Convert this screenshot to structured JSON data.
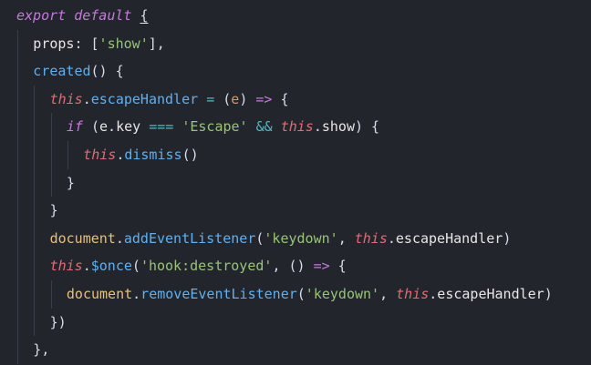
{
  "editor": {
    "background": "#22262c",
    "lines": [
      {
        "indent": 0,
        "tokens": [
          {
            "t": "export",
            "c": "kw"
          },
          {
            "t": " ",
            "c": "plain"
          },
          {
            "t": "default",
            "c": "kw"
          },
          {
            "t": " ",
            "c": "plain"
          },
          {
            "t": "{",
            "c": "punc cursor-underline"
          }
        ]
      },
      {
        "indent": 1,
        "tokens": [
          {
            "t": "props",
            "c": "prop"
          },
          {
            "t": ": [",
            "c": "punc"
          },
          {
            "t": "'show'",
            "c": "str"
          },
          {
            "t": "],",
            "c": "punc"
          }
        ]
      },
      {
        "indent": 1,
        "tokens": [
          {
            "t": "created",
            "c": "fn"
          },
          {
            "t": "() {",
            "c": "punc"
          }
        ]
      },
      {
        "indent": 2,
        "tokens": [
          {
            "t": "this",
            "c": "this"
          },
          {
            "t": ".",
            "c": "punc"
          },
          {
            "t": "escapeHandler",
            "c": "fn"
          },
          {
            "t": " ",
            "c": "plain"
          },
          {
            "t": "=",
            "c": "op"
          },
          {
            "t": " (",
            "c": "punc"
          },
          {
            "t": "e",
            "c": "param"
          },
          {
            "t": ") ",
            "c": "punc"
          },
          {
            "t": "=>",
            "c": "kw-plain"
          },
          {
            "t": " {",
            "c": "punc"
          }
        ]
      },
      {
        "indent": 3,
        "tokens": [
          {
            "t": "if",
            "c": "kw"
          },
          {
            "t": " (",
            "c": "punc"
          },
          {
            "t": "e",
            "c": "plain"
          },
          {
            "t": ".",
            "c": "punc"
          },
          {
            "t": "key",
            "c": "prop"
          },
          {
            "t": " ",
            "c": "plain"
          },
          {
            "t": "===",
            "c": "op"
          },
          {
            "t": " ",
            "c": "plain"
          },
          {
            "t": "'Escape'",
            "c": "str"
          },
          {
            "t": " ",
            "c": "plain"
          },
          {
            "t": "&&",
            "c": "op"
          },
          {
            "t": " ",
            "c": "plain"
          },
          {
            "t": "this",
            "c": "this"
          },
          {
            "t": ".",
            "c": "punc"
          },
          {
            "t": "show",
            "c": "prop"
          },
          {
            "t": ") {",
            "c": "punc"
          }
        ]
      },
      {
        "indent": 4,
        "tokens": [
          {
            "t": "this",
            "c": "this"
          },
          {
            "t": ".",
            "c": "punc"
          },
          {
            "t": "dismiss",
            "c": "fn"
          },
          {
            "t": "()",
            "c": "punc"
          }
        ]
      },
      {
        "indent": 3,
        "tokens": [
          {
            "t": "}",
            "c": "punc"
          }
        ]
      },
      {
        "indent": 2,
        "tokens": [
          {
            "t": "}",
            "c": "punc"
          }
        ]
      },
      {
        "indent": 2,
        "tokens": [
          {
            "t": "document",
            "c": "obj"
          },
          {
            "t": ".",
            "c": "punc"
          },
          {
            "t": "addEventListener",
            "c": "fn"
          },
          {
            "t": "(",
            "c": "punc"
          },
          {
            "t": "'keydown'",
            "c": "str"
          },
          {
            "t": ", ",
            "c": "punc"
          },
          {
            "t": "this",
            "c": "this"
          },
          {
            "t": ".",
            "c": "punc"
          },
          {
            "t": "escapeHandler",
            "c": "prop"
          },
          {
            "t": ")",
            "c": "punc"
          }
        ]
      },
      {
        "indent": 2,
        "tokens": [
          {
            "t": "this",
            "c": "this"
          },
          {
            "t": ".",
            "c": "punc"
          },
          {
            "t": "$once",
            "c": "fn"
          },
          {
            "t": "(",
            "c": "punc"
          },
          {
            "t": "'hook:destroyed'",
            "c": "str"
          },
          {
            "t": ", () ",
            "c": "punc"
          },
          {
            "t": "=>",
            "c": "kw-plain"
          },
          {
            "t": " {",
            "c": "punc"
          }
        ]
      },
      {
        "indent": 3,
        "tokens": [
          {
            "t": "document",
            "c": "obj"
          },
          {
            "t": ".",
            "c": "punc"
          },
          {
            "t": "removeEventListener",
            "c": "fn"
          },
          {
            "t": "(",
            "c": "punc"
          },
          {
            "t": "'keydown'",
            "c": "str"
          },
          {
            "t": ", ",
            "c": "punc"
          },
          {
            "t": "this",
            "c": "this"
          },
          {
            "t": ".",
            "c": "punc"
          },
          {
            "t": "escapeHandler",
            "c": "prop"
          },
          {
            "t": ")",
            "c": "punc"
          }
        ]
      },
      {
        "indent": 2,
        "tokens": [
          {
            "t": "})",
            "c": "punc"
          }
        ]
      },
      {
        "indent": 1,
        "tokens": [
          {
            "t": "},",
            "c": "punc"
          }
        ]
      }
    ]
  }
}
